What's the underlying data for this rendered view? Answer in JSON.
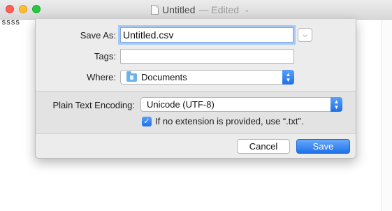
{
  "window": {
    "title": "Untitled",
    "title_status": "— Edited",
    "editor_text": "ssss"
  },
  "dialog": {
    "save_as_label": "Save As:",
    "save_as_value": "Untitled.csv",
    "tags_label": "Tags:",
    "tags_value": "",
    "where_label": "Where:",
    "where_value": "Documents",
    "encoding_label": "Plain Text Encoding:",
    "encoding_value": "Unicode (UTF-8)",
    "extension_checkbox_label": "If no extension is provided, use “.txt”.",
    "extension_checked": true,
    "cancel_label": "Cancel",
    "save_label": "Save"
  },
  "icons": {
    "stepper": "up-down-chevron-icon",
    "folder": "documents-folder-icon",
    "expand": "chevron-down-icon",
    "check": "checkmark-icon"
  },
  "colors": {
    "accent": "#1f70e6",
    "focus_ring": "#a9c9f5",
    "close": "#ff5f57",
    "minimize": "#febc2e",
    "zoom": "#28c840"
  }
}
